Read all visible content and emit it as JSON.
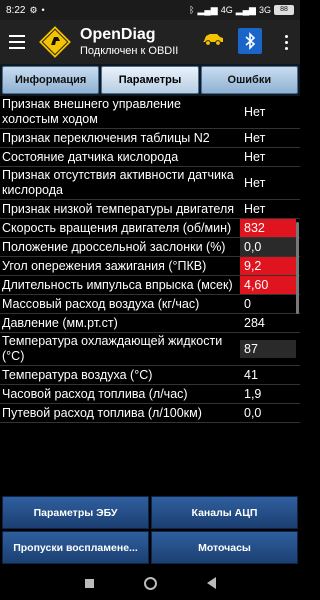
{
  "status_bar": {
    "time": "8:22",
    "network_left": "4G",
    "network_right": "3G",
    "battery": "88"
  },
  "app_bar": {
    "title": "OpenDiag",
    "subtitle": "Подключен к OBDII"
  },
  "tabs": [
    {
      "label": "Информация",
      "active": false
    },
    {
      "label": "Параметры",
      "active": true
    },
    {
      "label": "Ошибки",
      "active": false
    }
  ],
  "parameters": [
    {
      "name": "Признак внешнего управление холостым ходом",
      "value": "Нет",
      "highlight": "none"
    },
    {
      "name": "Признак переключения таблицы N2",
      "value": "Нет",
      "highlight": "none"
    },
    {
      "name": "Состояние датчика кислорода",
      "value": "Нет",
      "highlight": "none"
    },
    {
      "name": "Признак отсутствия активности датчика кислорода",
      "value": "Нет",
      "highlight": "none"
    },
    {
      "name": "Признак низкой температуры двигателя",
      "value": "Нет",
      "highlight": "none"
    },
    {
      "name": "Скорость вращения двигателя (об/мин)",
      "value": "832",
      "highlight": "red"
    },
    {
      "name": "Положение дроссельной заслонки (%)",
      "value": "0,0",
      "highlight": "grey"
    },
    {
      "name": "Угол опережения зажигания (°ПКВ)",
      "value": "9,2",
      "highlight": "red"
    },
    {
      "name": "Длительность импульса впрыска (мсек)",
      "value": "4,60",
      "highlight": "red"
    },
    {
      "name": "Массовый расход воздуха (кг/час)",
      "value": "0",
      "highlight": "none"
    },
    {
      "name": "Давление (мм.рт.ст)",
      "value": "284",
      "highlight": "none"
    },
    {
      "name": "Температура охлаждающей жидкости (°C)",
      "value": "87",
      "highlight": "grey"
    },
    {
      "name": "Температура воздуха (°C)",
      "value": "41",
      "highlight": "none"
    },
    {
      "name": "Часовой расход топлива (л/час)",
      "value": "1,9",
      "highlight": "none"
    },
    {
      "name": "Путевой расход топлива (л/100км)",
      "value": "0,0",
      "highlight": "none"
    }
  ],
  "bottom_buttons": [
    {
      "label": "Параметры ЭБУ"
    },
    {
      "label": "Каналы АЦП"
    },
    {
      "label": "Пропуски воспламене..."
    },
    {
      "label": "Моточасы"
    }
  ],
  "colors": {
    "highlight_red": "#e0141e",
    "button_blue": "#2f5f9e",
    "tab_blue": "#b7cde3",
    "bluetooth_blue": "#1a66c8"
  },
  "icons": [
    "menu-icon",
    "opendiag-logo-icon",
    "car-icon",
    "bluetooth-icon",
    "more-vert-icon"
  ]
}
